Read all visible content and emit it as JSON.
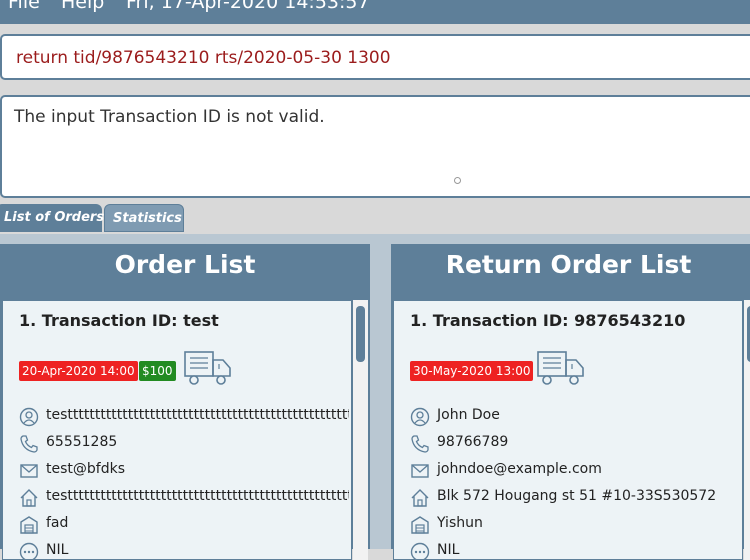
{
  "menu": {
    "file": "File",
    "help": "Help",
    "datetime": "Fri, 17-Apr-2020 14:53:57"
  },
  "command": {
    "value": "return tid/9876543210 rts/2020-05-30 1300"
  },
  "result": {
    "message": "The input Transaction ID is not valid."
  },
  "tabs": [
    {
      "label": "List of Orders"
    },
    {
      "label": "Statistics"
    }
  ],
  "order_pane": {
    "title": "Order List",
    "card": {
      "header": "1.  Transaction ID: test",
      "timestamp": "20-Apr-2020 14:00",
      "price": "$100",
      "name": "testtttttttttttttttttttttttttttttttttttttttttttttttttttt...",
      "phone": "65551285",
      "email": "test@bfdks",
      "address": "testtttttttttttttttttttttttttttttttttttttttttttttttttttt...",
      "warehouse": "fad",
      "comment": "NIL"
    }
  },
  "return_pane": {
    "title": "Return Order List",
    "card": {
      "header": "1.  Transaction ID: 9876543210",
      "timestamp": "30-May-2020 13:00",
      "name": "John Doe",
      "phone": "98766789",
      "email": "johndoe@example.com",
      "address": "Blk 572 Hougang st 51 #10-33S530572",
      "warehouse": "Yishun",
      "comment": "NIL"
    }
  },
  "colors": {
    "accent": "#5e7f99",
    "error_text": "#9b1c1c",
    "badge_red": "#ee2222",
    "badge_green": "#228b22"
  },
  "icons": [
    "user-icon",
    "phone-icon",
    "mail-icon",
    "home-icon",
    "warehouse-icon",
    "comment-icon",
    "truck-icon"
  ]
}
